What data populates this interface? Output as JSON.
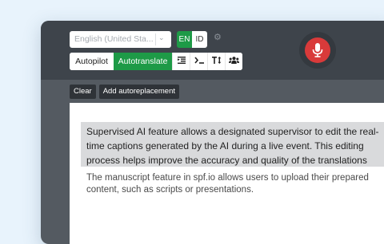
{
  "toolbar": {
    "language_select": "English (United Sta...",
    "language_toggle": {
      "en": "EN",
      "id": "ID"
    },
    "modes": {
      "autopilot": "Autopilot",
      "autotranslate": "Autotranslate"
    },
    "tool_icons": [
      "indent-icon",
      "terminal-icon",
      "text-size-icon",
      "users-icon"
    ],
    "mic_icon": "microphone-icon"
  },
  "actions": {
    "clear": "Clear",
    "add_autoreplacement": "Add autoreplacement"
  },
  "content": {
    "caption": "Supervised AI feature allows a designated supervisor to edit the real-time captions generated by the AI during a live event. This editing process helps improve the accuracy and quality of the translations",
    "manuscript": "The manuscript feature in spf.io allows users to upload their prepared content, such as scripts or presentations."
  },
  "colors": {
    "accent_green": "#1e9a47",
    "mic_red": "#d93a3a",
    "toolbar": "#3e444b",
    "background": "#e8f3fc"
  }
}
